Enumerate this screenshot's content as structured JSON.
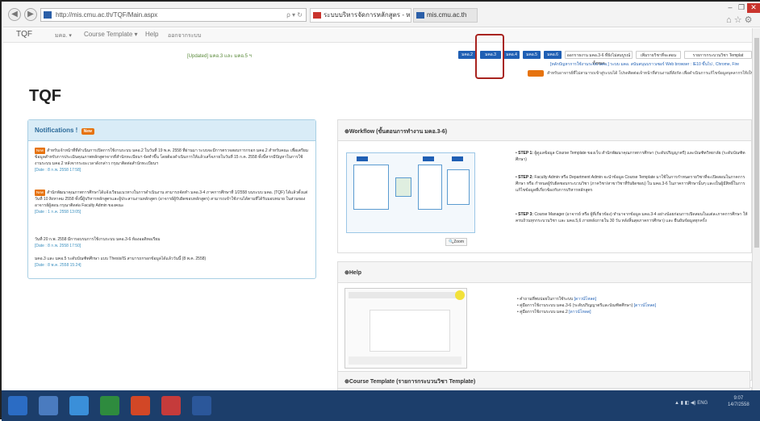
{
  "browser": {
    "address": "http://mis.cmu.ac.th/TQF/Main.aspx",
    "address_icons": "ρ ▾ ↻",
    "tabs": [
      {
        "label": "ระบบบริหารจัดการหลักสูตร - หน้าหลัก",
        "active": true
      },
      {
        "label": "mis.cmu.ac.th",
        "active": false
      }
    ],
    "window_controls": {
      "minimize": "–",
      "maximize": "❐",
      "close": "✕"
    },
    "right_icons": "⌂ ☆ ⚙"
  },
  "navbar": {
    "brand": "TQF",
    "items": [
      "มคอ. ▾",
      "Course Template ▾",
      "Help",
      "ออกจากระบบ"
    ]
  },
  "notice": {
    "updated": "[Updated] มคอ.3 และ มคอ.5 ฯ"
  },
  "top_buttons": [
    {
      "label": "มคอ.2"
    },
    {
      "label": "มคอ.3"
    },
    {
      "label": "มคอ.4"
    },
    {
      "label": "มคอ.5"
    },
    {
      "label": "มคอ.6"
    },
    {
      "label": "ออกรายงาน มคอ.3-6 ที่ยังไม่สมบูรณ์ทั้งหมด"
    },
    {
      "label": "เพิ่มรายวิชาที่จะสอน"
    },
    {
      "label": "รายการกระบวนวิชา Templat"
    }
  ],
  "info_lines": [
    {
      "text": "[หลักปัญหาการใช้งานระบบ มคอ.] ระบบ มคอ. สนับสนุนบราวเซอร์ Web browser : IE10 ขึ้นไป , Chrome, Fire"
    },
    {
      "text": "สำหรับอาจารย์ที่ไม่สามารถเข้าสู่ระบบได้ โปรดติดต่อเจ้าหน้าที่ส่วนงานที่สังกัด เพื่อดำเนินการแก้ไขข้อมูลบุคลากรให้เป็นปัจจุบัน"
    }
  ],
  "page_title": "TQF",
  "notifications": {
    "title": "Notifications !",
    "new_badge": "New",
    "items": [
      {
        "new": true,
        "text": "สำหรับเจ้าหน้าที่ที่ดำเนินการเปิดการใช้งานระบบ มคอ.2 ในวันที่ 19 พ.ค. 2558 ที่ผ่านมา ระบบจะมีการตรวจสอบการกรอก มคอ.2 สำหรับคณะ เพื่อเตรียมข้อมูลสำหรับการประเมินคุณภาพหลักสูตรจากที่สำนักทะเบียนฯ จัดทำขึ้น โดยต้องดำเนินการให้แล้วเสร็จภายในวันที่ 15 ก.ค. 2558 ทั้งนี้หากมีปัญหาในการใช้งานระบบ มคอ.2 หลังจากระยะเวลาดังกล่าว กรุณาติดต่อสำนักทะเบียนฯ",
        "date": "[Date : 8 ก.พ. 2558 17:58]"
      },
      {
        "new": true,
        "text": "สำนักพัฒนาคุณภาพการศึกษาได้แจ้งเวียนแนวทางในการดำเนินงาน สามารถจัดทำ มคอ.3-4 ภาคการศึกษาที่ 1/2558 บนระบบ มคอ. (TQF) ได้แล้วตั้งแต่วันที่ 10 สิงหาคม 2558 ทั้งนี้ผู้บริหารหลักสูตรและผู้ประสานงานหลักสูตร (อาจารย์ผู้รับผิดชอบหลักสูตร) สามารถเข้าใช้งานได้ตามที่ได้รับมอบหมาย ในส่วนของอาจารย์ผู้สอน กรุณาติดต่อ Faculty Admin ของคณะ",
        "date": "[Date : 1 ก.ค. 2558 13:05]"
      },
      {
        "new": false,
        "text": "วันที่ 20 ก.พ. 2558 มีการอบรมการใช้งานระบบ มคอ.3-6 ห้องออดิทอเรียม",
        "date": "[Date : 8 ก.พ. 2558 17:50]"
      },
      {
        "new": false,
        "text": "มคอ.3 และ มคอ.5 ระดับบัณฑิตศึกษา แบบ Thesis/IS สามารถกรอกข้อมูลได้แล้ววันนี้ (8 พ.ค. 2558)",
        "date": "[Date : 8 พ.ค. 2558 15:24]"
      }
    ]
  },
  "workflow": {
    "title": "⊕Workflow (ขั้นตอนการทำงาน มคอ.3-6)",
    "zoom_label": "🔍Zoom",
    "steps": [
      {
        "label": "STEP 1:",
        "text": "ผู้ดูแลข้อมูล Course Template ของเว็บ สำนักพัฒนาคุณภาพการศึกษา (ระดับปริญญาตรี) และบัณฑิตวิทยาลัย (ระดับบัณฑิตศึกษา)"
      },
      {
        "label": "STEP 2:",
        "text": "Faculty Admin หรือ Department Admin จะนำข้อมูล Course Template มาใช้ในการกำหนดรายวิชาที่จะเปิดสอนในภาคการศึกษา หรือ กำหนดผู้รับผิดชอบกระบวนวิชา (ภาควิชา/สาขาวิชาที่รับผิดชอบ) ใน มคอ.3-6 ในภาคการศึกษานั้นๆ และเป็นผู้มีสิทธิ์ในการแก้ไขข้อมูลที่เกี่ยวข้องกับการบริหารหลักสูตร"
      },
      {
        "label": "STEP 3:",
        "text": "Course Manager (อาจารย์ หรือ ผู้ที่เกี่ยวข้อง) ทำมาจากข้อมูล มคอ.3-4 อย่างน้อยก่อนการเปิดสอนในแต่ละภาคการศึกษา ให้ครบถ้วนทุกกระบวนวิชา และ มคอ.5,6 ภายหลังภายใน 30 วัน หลังสิ้นสุดภาคการศึกษา) และ ยืนยันข้อมูลทุกครั้ง"
      }
    ]
  },
  "help": {
    "title": "⊕Help",
    "links": [
      {
        "text": "คำถามที่พบบ่อยในการใช้ระบบ",
        "link": "[ดาวน์โหลด]"
      },
      {
        "text": "คู่มือการใช้งานระบบ มคอ.3-6 (ระดับปริญญาตรีและบัณฑิตศึกษา)",
        "link": "[ดาวน์โหลด]"
      },
      {
        "text": "คู่มือการใช้งานระบบ มคอ.2",
        "link": "[ดาวน์โหลด]"
      }
    ]
  },
  "course_template": {
    "title": "⊕Course Template (รายการกระบวนวิชา Template)"
  },
  "taskbar": {
    "tray_text": "▲ ▮ ◧ ◀) ENG",
    "time": "9:07",
    "date": "14/7/2558"
  },
  "colors": {
    "primary_button": "#1f5fb4",
    "highlight_box": "#a8231f",
    "new_badge": "#e6730f",
    "panel_head": "#d9ecf7",
    "taskbar": "#1c3e6b"
  }
}
